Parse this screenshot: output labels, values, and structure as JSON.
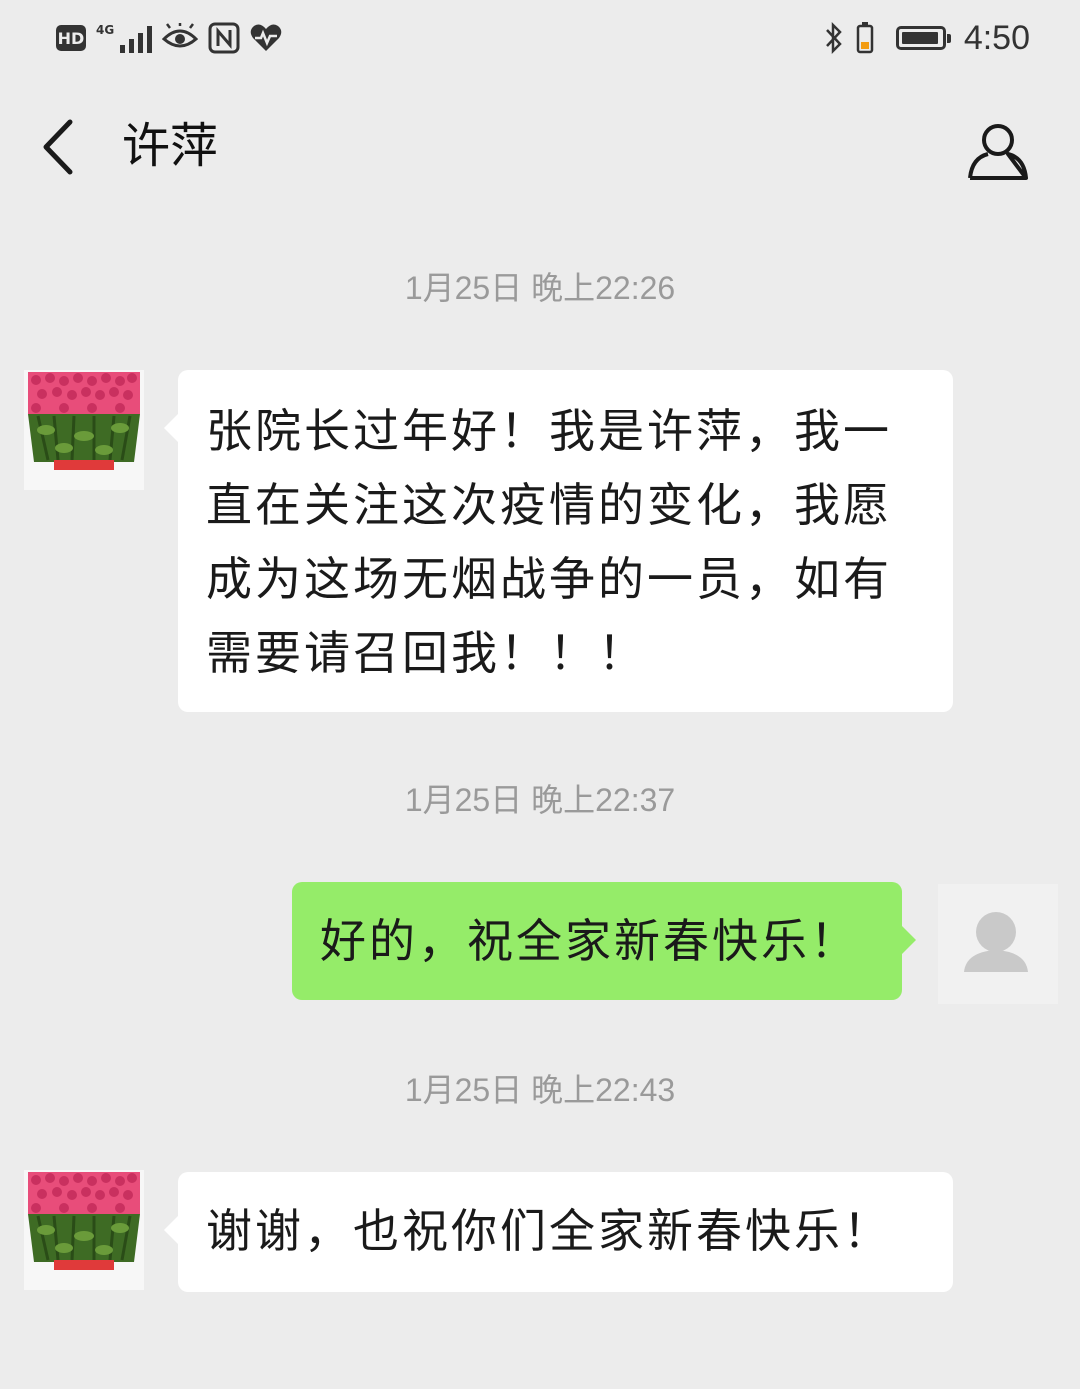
{
  "status_bar": {
    "left_icons": [
      "hd-icon",
      "signal-4g-icon",
      "eye-icon",
      "nfc-icon",
      "heart-health-icon"
    ],
    "hd_label": "HD",
    "network_label": "4G",
    "right_icons": [
      "bluetooth-icon",
      "battery-icon"
    ],
    "time": "4:50"
  },
  "header": {
    "title": "许萍",
    "back_icon": "chevron-left-icon",
    "profile_icon": "person-icon"
  },
  "messages": [
    {
      "timestamp": "1月25日 晚上22:26",
      "direction": "incoming",
      "text": "张院长过年好！我是许萍，我一直在关注这次疫情的变化，我愿成为这场无烟战争的一员，如有需要请召回我！！！"
    },
    {
      "timestamp": "1月25日 晚上22:37",
      "direction": "outgoing",
      "text": "好的，祝全家新春快乐！"
    },
    {
      "timestamp": "1月25日 晚上22:43",
      "direction": "incoming",
      "text": "谢谢，也祝你们全家新春快乐！"
    }
  ],
  "colors": {
    "background": "#ececec",
    "incoming_bubble": "#ffffff",
    "outgoing_bubble": "#95ec69",
    "timestamp": "#9a9a9a"
  }
}
